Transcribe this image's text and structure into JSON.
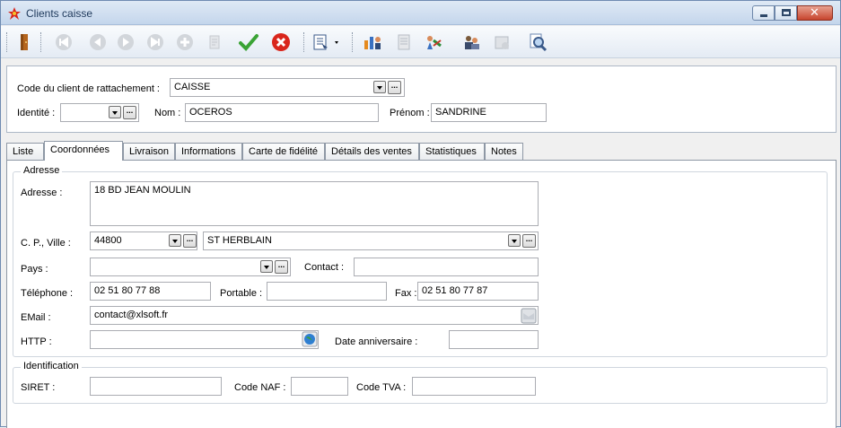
{
  "window": {
    "title": "Clients caisse"
  },
  "header": {
    "client_code_label": "Code du client de rattachement :",
    "client_code_value": "CAISSE",
    "identity_label": "Identité :",
    "identity_value": "",
    "name_label": "Nom :",
    "name_value": "OCEROS",
    "firstname_label": "Prénom :",
    "firstname_value": "SANDRINE"
  },
  "tabs": [
    {
      "label": "Liste"
    },
    {
      "label": "Coordonnées"
    },
    {
      "label": "Livraison"
    },
    {
      "label": "Informations"
    },
    {
      "label": "Carte de fidélité"
    },
    {
      "label": "Détails des ventes"
    },
    {
      "label": "Statistiques"
    },
    {
      "label": "Notes"
    }
  ],
  "active_tab": "Coordonnées",
  "address_group": {
    "title": "Adresse",
    "address_label": "Adresse :",
    "address_value": "18 BD JEAN MOULIN",
    "cp_city_label": "C. P., Ville :",
    "cp_value": "44800",
    "city_value": "ST HERBLAIN",
    "country_label": "Pays :",
    "country_value": "",
    "contact_label": "Contact :",
    "contact_value": "",
    "phone_label": "Téléphone :",
    "phone_value": "02 51 80 77 88",
    "mobile_label": "Portable :",
    "mobile_value": "",
    "fax_label": "Fax :",
    "fax_value": "02 51 80 77 87",
    "email_label": "EMail :",
    "email_value": "contact@xlsoft.fr",
    "http_label": "HTTP :",
    "http_value": "",
    "birthday_label": "Date anniversaire :",
    "birthday_value": ""
  },
  "identification_group": {
    "title": "Identification",
    "siret_label": "SIRET :",
    "siret_value": "",
    "naf_label": "Code NAF :",
    "naf_value": "",
    "tva_label": "Code TVA :",
    "tva_value": ""
  },
  "colors": {
    "titlebar": "#c4d6ec",
    "close_button": "#c7442d",
    "validate_green": "#3aa335",
    "cancel_red": "#d9261c"
  },
  "icons": {
    "toolbar": [
      "exit-door-icon",
      "first-record-icon",
      "previous-record-icon",
      "next-record-icon",
      "last-record-icon",
      "add-record-icon",
      "delete-record-icon",
      "validate-icon",
      "cancel-icon",
      "print-menu-icon",
      "clients-icon",
      "document-icon",
      "transfer-icon",
      "contacts-icon",
      "archive-icon",
      "search-icon"
    ]
  }
}
